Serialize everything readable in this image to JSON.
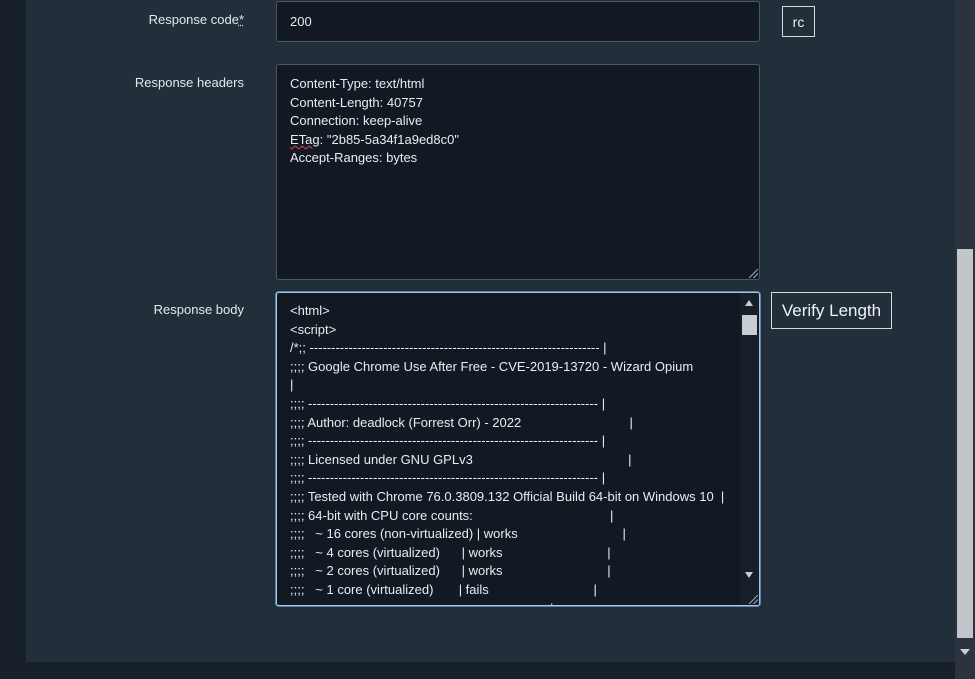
{
  "response_code": {
    "label": "Response code",
    "required_mark": "*",
    "value": "200",
    "button": "rc"
  },
  "response_headers": {
    "label": "Response headers",
    "lines": [
      "Content-Type: text/html",
      "Content-Length: 40757",
      "Connection: keep-alive",
      "ETag: \"2b85-5a34f1a9ed8c0\"",
      "Accept-Ranges: bytes"
    ]
  },
  "response_body": {
    "label": "Response body",
    "button": "Verify Length",
    "lines": [
      "<html>",
      "<script>",
      "/*;; ------------------------------------------------------------------- |",
      ";;;; Google Chrome Use After Free - CVE-2019-13720 - Wizard Opium",
      "|",
      ";;;; ------------------------------------------------------------------- |",
      ";;;; Author: deadlock (Forrest Orr) - 2022                              |",
      ";;;; ------------------------------------------------------------------- |",
      ";;;; Licensed under GNU GPLv3                                           |",
      ";;;; ------------------------------------------------------------------- |",
      ";;;; Tested with Chrome 76.0.3809.132 Official Build 64-bit on Windows 10  |",
      ";;;; 64-bit with CPU core counts:                                      |",
      ";;;;   ~ 16 cores (non-virtualized) | works                             |",
      ";;;;   ~ 4 cores (virtualized)      | works                             |",
      ";;;;   ~ 2 cores (virtualized)      | works                             |",
      ";;;;   ~ 1 core (virtualized)       | fails                             |",
      ";;;;                                                                    |"
    ]
  }
}
